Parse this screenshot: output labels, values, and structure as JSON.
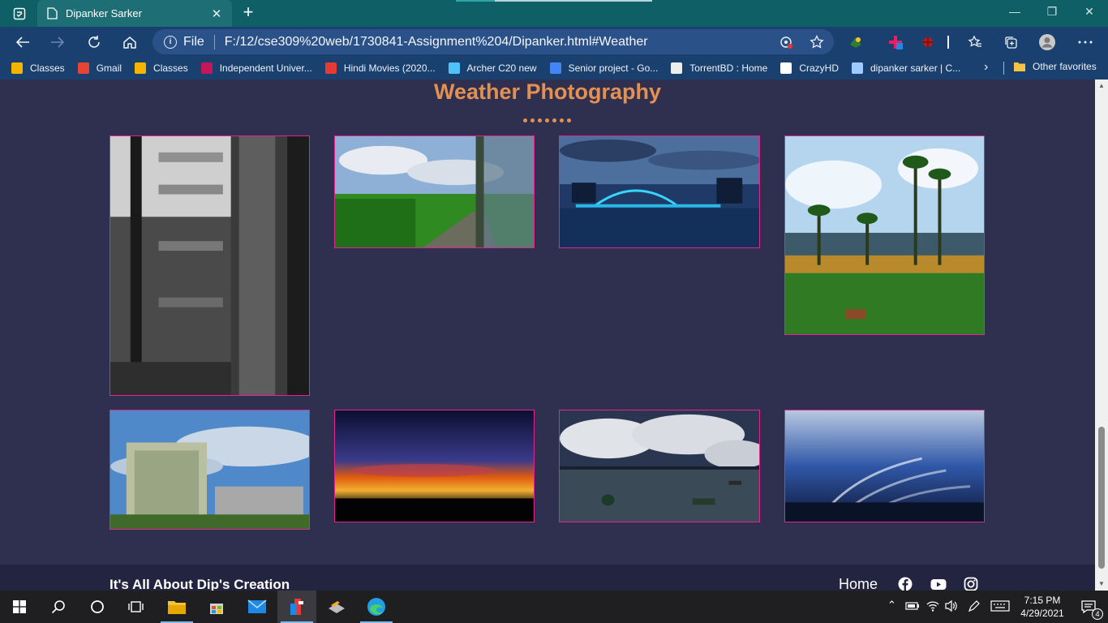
{
  "browser": {
    "tab_title": "Dipanker Sarker",
    "tab_close": "✕",
    "new_tab": "+",
    "scheme_label": "File",
    "url": "F:/12/cse309%20web/1730841-Assignment%204/Dipanker.html#Weather",
    "window_controls": {
      "minimize": "—",
      "restore": "❐",
      "close": "✕"
    }
  },
  "bookmarks": [
    {
      "label": "Classes",
      "icon": "google-classroom-icon",
      "color": "#f4b400"
    },
    {
      "label": "Gmail",
      "icon": "gmail-icon",
      "color": "#ea4335"
    },
    {
      "label": "Classes",
      "icon": "google-classroom-icon",
      "color": "#f4b400"
    },
    {
      "label": "Independent Univer...",
      "icon": "university-icon",
      "color": "#c2185b"
    },
    {
      "label": "Hindi Movies (2020...",
      "icon": "movie-icon",
      "color": "#e53935"
    },
    {
      "label": "Archer C20 new",
      "icon": "router-icon",
      "color": "#4fc3f7"
    },
    {
      "label": "Senior project - Go...",
      "icon": "google-docs-icon",
      "color": "#4285f4"
    },
    {
      "label": "TorrentBD : Home",
      "icon": "torrentbd-icon",
      "color": "#eeeeee"
    },
    {
      "label": "CrazyHD",
      "icon": "page-icon",
      "color": "#ffffff"
    },
    {
      "label": "dipanker sarker | C...",
      "icon": "link-icon",
      "color": "#9ecbff"
    }
  ],
  "bookmarks_other": "Other favorites",
  "page": {
    "section_title": "Weather Photography",
    "photos": [
      {
        "name": "photo-rainy-window",
        "colors": [
          "#e8e8e8",
          "#5a5a5a",
          "#111111"
        ]
      },
      {
        "name": "photo-road-clouds",
        "colors": [
          "#9fb7d4",
          "#2f8a22",
          "#6b6b5e"
        ]
      },
      {
        "name": "photo-bridge-night",
        "colors": [
          "#4c6f9e",
          "#13305a",
          "#0d1f3c"
        ]
      },
      {
        "name": "photo-palm-trees",
        "colors": [
          "#b5d5ef",
          "#2f7a22",
          "#9a7d2a"
        ]
      },
      {
        "name": "photo-building-sky",
        "colors": [
          "#4f89c9",
          "#c9d7e6",
          "#3f6a2a"
        ]
      },
      {
        "name": "photo-sunset",
        "colors": [
          "#0a0f30",
          "#e05a10",
          "#05050a"
        ]
      },
      {
        "name": "photo-river-clouds",
        "colors": [
          "#2a3550",
          "#d9dce2",
          "#3a4a56"
        ]
      },
      {
        "name": "photo-kash-flowers",
        "colors": [
          "#b8c8e0",
          "#3058a8",
          "#0f1838"
        ]
      }
    ],
    "footer_text": "It's All About Dip's Creation",
    "footer_home": "Home"
  },
  "taskbar": {
    "time": "7:15 PM",
    "date": "4/29/2021",
    "notifications": "4"
  }
}
